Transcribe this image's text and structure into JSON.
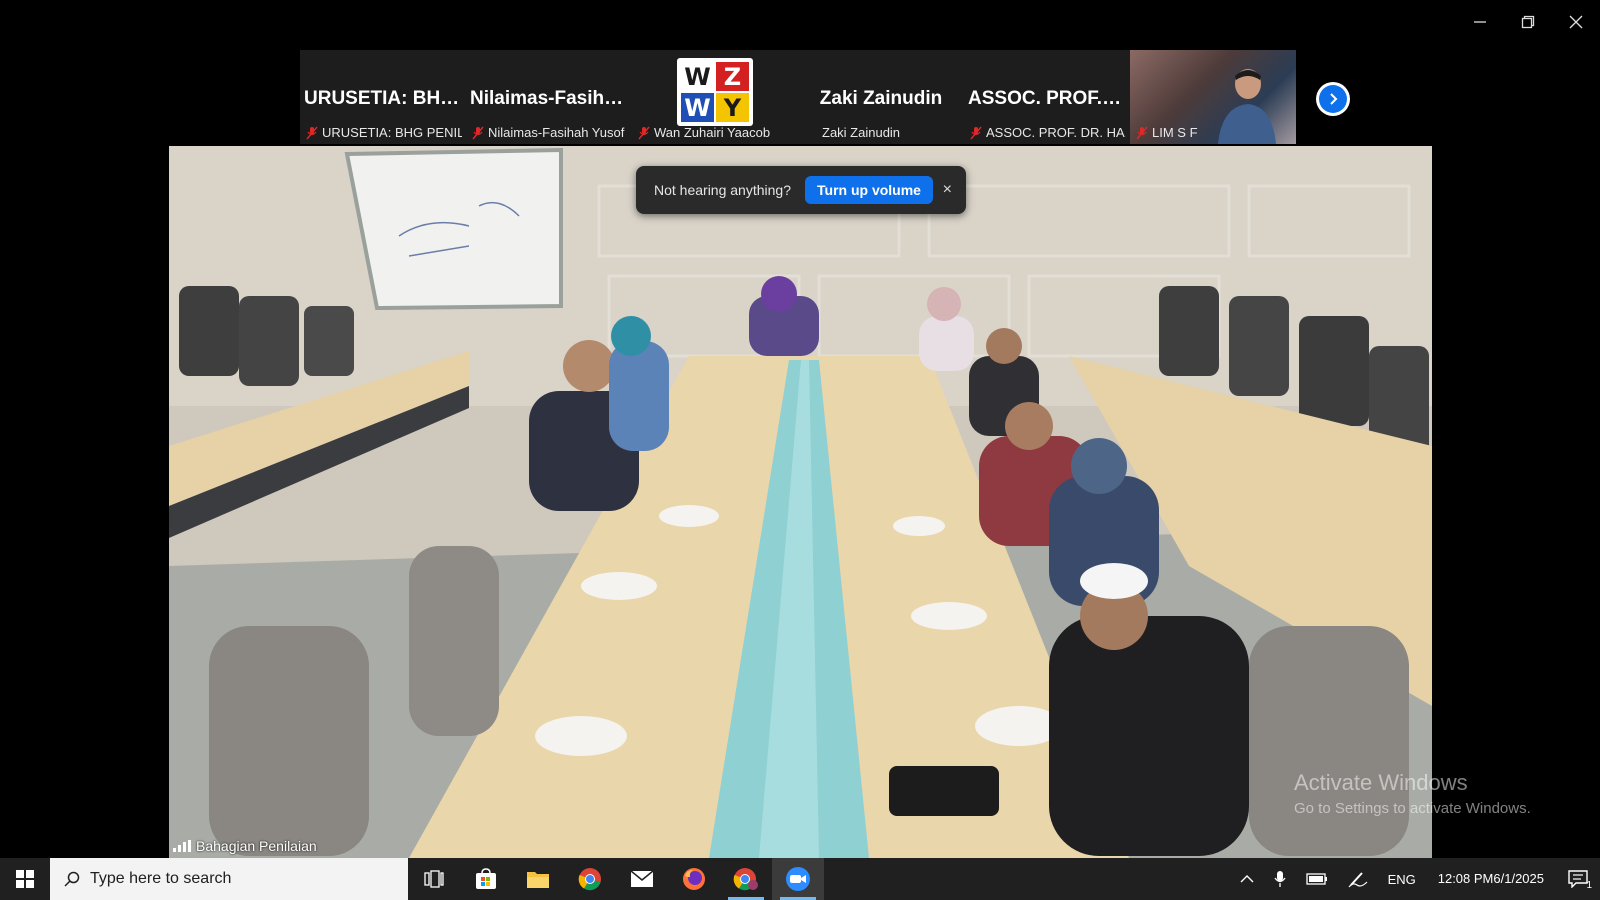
{
  "window": {
    "minimize_icon": "minimize-icon",
    "restore_icon": "restore-icon",
    "close_icon": "close-icon"
  },
  "participants": [
    {
      "title": "URUSETIA: BHG...",
      "label": "URUSETIA: BHG PENIL...",
      "muted": true
    },
    {
      "title": "Nilaimas-Fasiha...",
      "label": "Nilaimas-Fasihah Yusof",
      "muted": true
    },
    {
      "title": "",
      "label": "Wan Zuhairi Yaacob",
      "muted": true,
      "logo": [
        "W",
        "Z",
        "W",
        "Y"
      ]
    },
    {
      "title": "Zaki Zainudin",
      "label": "Zaki Zainudin",
      "muted": false
    },
    {
      "title": "ASSOC. PROF. D...",
      "label": "ASSOC. PROF. DR. HA...",
      "muted": true
    },
    {
      "title": "",
      "label": "LIM S F",
      "muted": true,
      "video": true
    }
  ],
  "main_video": {
    "speaker": "Bahagian Penilaian"
  },
  "toast": {
    "message": "Not hearing anything?",
    "button": "Turn up volume",
    "close": "×"
  },
  "watermark": {
    "line1": "Activate Windows",
    "line2": "Go to Settings to activate Windows."
  },
  "taskbar": {
    "search_placeholder": "Type here to search",
    "language": "ENG",
    "time": "12:08 PM",
    "date": "6/1/2025",
    "notification_count": "1"
  },
  "colors": {
    "accent": "#0e71eb",
    "muted_mic": "#e02828",
    "taskbar": "#202020"
  }
}
